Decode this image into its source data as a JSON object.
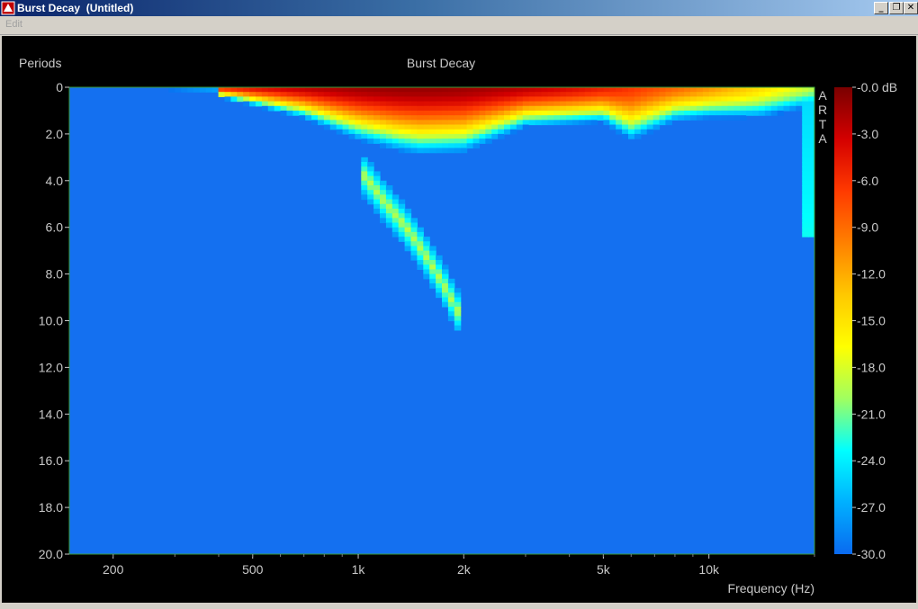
{
  "window": {
    "title": "Burst Decay  (Untitled)",
    "minimize_label": "_",
    "maximize_label": "❐",
    "close_label": "✕"
  },
  "menu": {
    "items": [
      {
        "label": "Edit"
      }
    ]
  },
  "chart_data": {
    "type": "heatmap",
    "title": "Burst Decay",
    "ylabel": "Periods",
    "xlabel": "Frequency (Hz)",
    "watermark": [
      "A",
      "R",
      "T",
      "A"
    ],
    "x_scale": "log",
    "xlim": [
      150,
      20000
    ],
    "ylim": [
      0,
      20
    ],
    "x_ticks": [
      {
        "value": 200,
        "label": "200"
      },
      {
        "value": 500,
        "label": "500"
      },
      {
        "value": 1000,
        "label": "1k"
      },
      {
        "value": 2000,
        "label": "2k"
      },
      {
        "value": 5000,
        "label": "5k"
      },
      {
        "value": 10000,
        "label": "10k"
      }
    ],
    "y_ticks": [
      {
        "value": 0,
        "label": "0"
      },
      {
        "value": 2,
        "label": "2.0"
      },
      {
        "value": 4,
        "label": "4.0"
      },
      {
        "value": 6,
        "label": "6.0"
      },
      {
        "value": 8,
        "label": "8.0"
      },
      {
        "value": 10,
        "label": "10.0"
      },
      {
        "value": 12,
        "label": "12.0"
      },
      {
        "value": 14,
        "label": "14.0"
      },
      {
        "value": 16,
        "label": "16.0"
      },
      {
        "value": 18,
        "label": "18.0"
      },
      {
        "value": 20,
        "label": "20.0"
      }
    ],
    "colorbar": {
      "min_db": -30,
      "max_db": 0,
      "labels": [
        "-0.0 dB",
        "-3.0",
        "-6.0",
        "-9.0",
        "-12.0",
        "-15.0",
        "-18.0",
        "-21.0",
        "-24.0",
        "-27.0",
        "-30.0"
      ],
      "colors": [
        "#7a0000",
        "#d40000",
        "#ff3a00",
        "#ff8000",
        "#ffc800",
        "#ffff00",
        "#a0ff60",
        "#00ffff",
        "#00b0ff",
        "#0a6af0"
      ]
    },
    "colors": {
      "background": "#000000",
      "floor": "#1470f0",
      "frame": "#3a9a3a"
    },
    "decay_envelope": {
      "description_points_freq_hz": [
        400,
        700,
        1000,
        1300,
        1500,
        2000,
        3000,
        5000,
        6000,
        8000,
        10000,
        14000,
        19000
      ],
      "floor_reach_periods": [
        0.6,
        1.8,
        3.0,
        3.6,
        3.8,
        3.7,
        2.3,
        2.1,
        3.3,
        2.2,
        2.1,
        2.3,
        1.8
      ]
    },
    "resonance_streak": {
      "freq_hz": [
        1000,
        1200,
        1400,
        1600,
        1800,
        1950
      ],
      "periods": [
        3.5,
        5.0,
        6.2,
        7.5,
        8.8,
        9.8
      ],
      "peak_db": -19
    }
  }
}
